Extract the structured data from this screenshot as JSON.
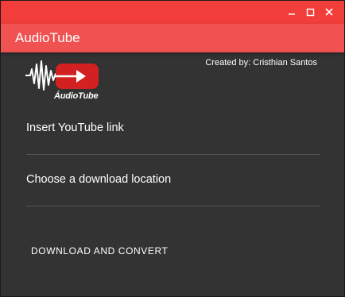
{
  "window": {
    "controls": {
      "minimize_icon": "minimize-icon",
      "maximize_icon": "maximize-icon",
      "close_icon": "close-icon"
    }
  },
  "appbar": {
    "title": "AudioTube"
  },
  "header": {
    "credit": "Created by: Cristhian Santos"
  },
  "logo": {
    "text": "ÁudioTube"
  },
  "form": {
    "link_placeholder": "Insert YouTube link",
    "location_placeholder": "Choose a download location"
  },
  "actions": {
    "download_label": "DOWNLOAD AND CONVERT"
  },
  "colors": {
    "titlebar": "#f23e3a",
    "appbar": "#f05252",
    "background": "#333333",
    "divider": "#555555",
    "logo_red": "#d32020"
  }
}
